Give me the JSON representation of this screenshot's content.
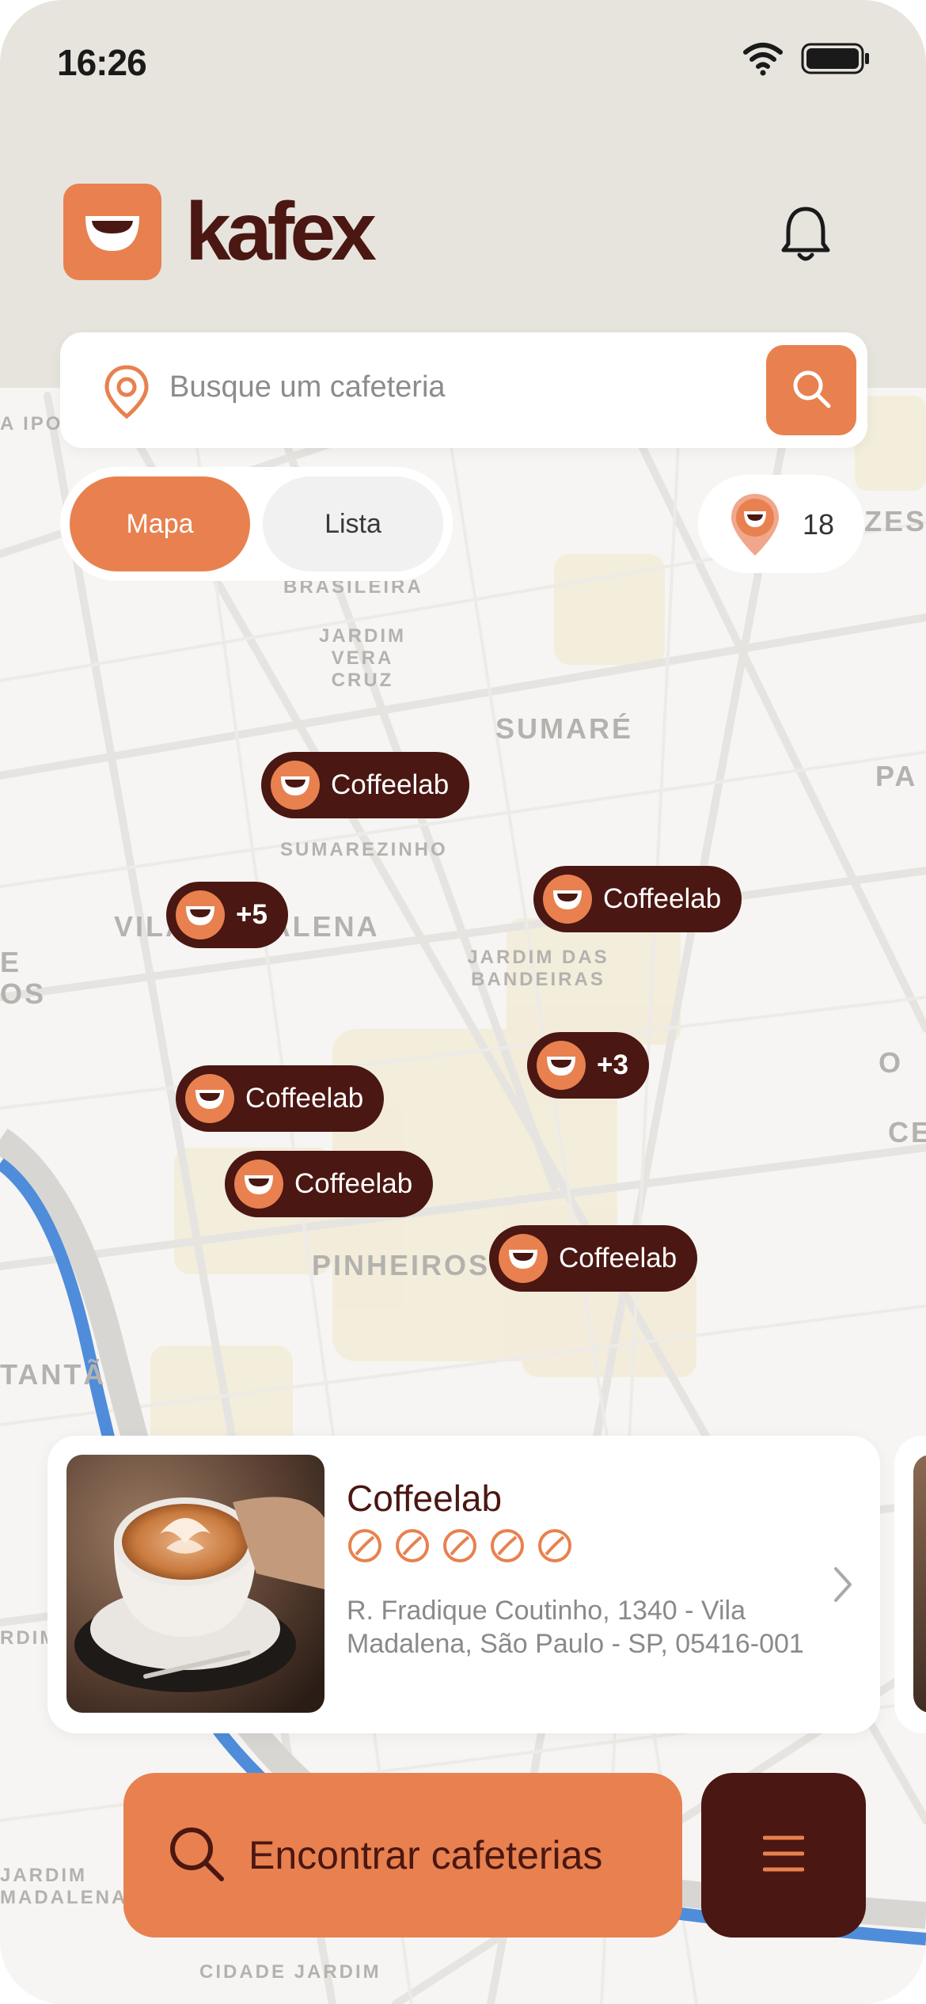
{
  "status_bar": {
    "time": "16:26"
  },
  "app": {
    "name": "kafex"
  },
  "search": {
    "placeholder": "Busque um cafeteria"
  },
  "view_toggle": {
    "options": [
      "Mapa",
      "Lista"
    ],
    "selected": "Mapa"
  },
  "results_count": "18",
  "map": {
    "labels": [
      "A IPO",
      "ZES",
      "BRASILEIRA",
      "JARDIM VERA CRUZ",
      "SUMARÉ",
      "PA",
      "SUMAREZINHO",
      "VILA MADALENA",
      "JARDIM DAS BANDEIRAS",
      "E OS",
      "O",
      "CE",
      "PINHEIROS",
      "TANTÃ",
      "RDIM",
      "JARDIM MADALENA",
      "CIDADE JARDIM"
    ],
    "markers": [
      {
        "label": "Coffeelab"
      },
      {
        "label": "+5"
      },
      {
        "label": "Coffeelab"
      },
      {
        "label": "+3"
      },
      {
        "label": "Coffeelab"
      },
      {
        "label": "Coffeelab"
      },
      {
        "label": "Coffeelab"
      }
    ]
  },
  "card": {
    "name": "Coffeelab",
    "rating": 5,
    "address": "R. Fradique Coutinho, 1340 - Vila Madalena, São Paulo - SP, 05416-001"
  },
  "cta": {
    "label": "Encontrar cafeterias"
  },
  "colors": {
    "accent": "#e8814f",
    "brand_dark": "#4a1712",
    "header_bg": "#e7e4de"
  },
  "icons": [
    "wifi-icon",
    "battery-icon",
    "bell-icon",
    "location-pin-icon",
    "search-icon",
    "coffee-bean-icon",
    "chevron-right-icon",
    "menu-icon"
  ]
}
